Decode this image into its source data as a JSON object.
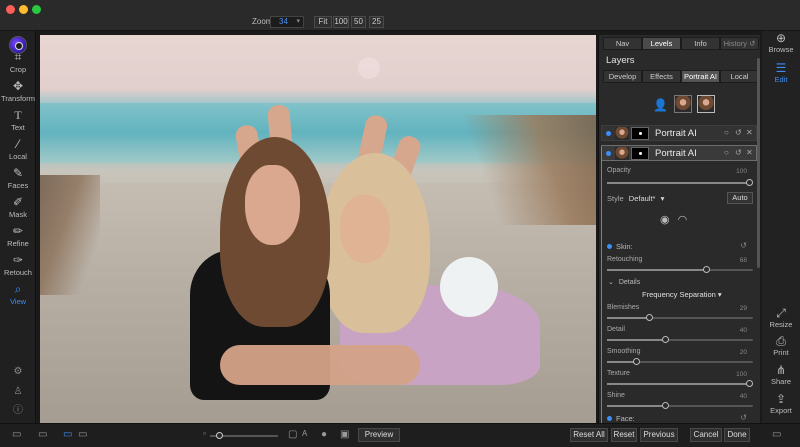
{
  "toolbar": {
    "zoom_label": "Zoom",
    "zoom_value": "34",
    "zoom_presets": [
      "Fit",
      "100",
      "50",
      "25"
    ]
  },
  "left_tools": [
    {
      "label": "Crop",
      "icon": "crop-icon"
    },
    {
      "label": "Transform",
      "icon": "transform-icon"
    },
    {
      "label": "Text",
      "icon": "text-icon"
    },
    {
      "label": "Local",
      "icon": "brush-icon"
    },
    {
      "label": "Faces",
      "icon": "faces-icon"
    },
    {
      "label": "Mask",
      "icon": "mask-icon"
    },
    {
      "label": "Refine",
      "icon": "refine-icon"
    },
    {
      "label": "Retouch",
      "icon": "retouch-icon"
    },
    {
      "label": "View",
      "icon": "view-icon",
      "active": true
    }
  ],
  "panel": {
    "tabs": [
      "Nav",
      "Levels",
      "Info",
      "History"
    ],
    "active_tab": "Levels",
    "title": "Layers",
    "subtabs": [
      "Develop",
      "Effects",
      "Portrait AI",
      "Local"
    ],
    "active_subtab": "Portrait AI",
    "layers": [
      {
        "name": "Portrait AI"
      },
      {
        "name": "Portrait AI"
      }
    ],
    "opacity": {
      "label": "Opacity",
      "value": "100"
    },
    "style": {
      "label": "Style",
      "value": "Default*"
    },
    "auto_label": "Auto",
    "skin": {
      "label": "Skin:",
      "retouching": {
        "label": "Retouching",
        "value": "68"
      },
      "details_label": "Details",
      "freq_label": "Frequency Separation",
      "blemishes": {
        "label": "Blemishes",
        "value": "29"
      },
      "detail": {
        "label": "Detail",
        "value": "40"
      },
      "smoothing": {
        "label": "Smoothing",
        "value": "20"
      },
      "texture": {
        "label": "Texture",
        "value": "100"
      },
      "shine": {
        "label": "Shine",
        "value": "40"
      }
    },
    "face_label": "Face:"
  },
  "right_tools": [
    {
      "label": "Browse",
      "icon": "browse-icon"
    },
    {
      "label": "Edit",
      "icon": "edit-icon",
      "active": true
    },
    {
      "label": "Resize",
      "icon": "resize-icon"
    },
    {
      "label": "Print",
      "icon": "print-icon"
    },
    {
      "label": "Share",
      "icon": "share-icon"
    },
    {
      "label": "Export",
      "icon": "export-icon"
    }
  ],
  "bottom": {
    "preview": "Preview",
    "reset_all": "Reset All",
    "reset": "Reset",
    "previous": "Previous",
    "cancel": "Cancel",
    "done": "Done"
  },
  "colors": {
    "accent": "#3d8ef5"
  }
}
